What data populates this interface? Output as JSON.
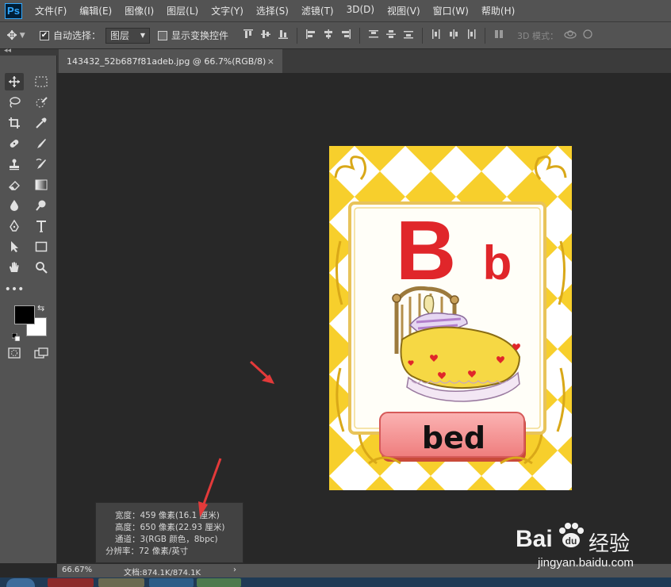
{
  "app": {
    "logo": "Ps"
  },
  "menu": [
    "文件(F)",
    "编辑(E)",
    "图像(I)",
    "图层(L)",
    "文字(Y)",
    "选择(S)",
    "滤镜(T)",
    "3D(D)",
    "视图(V)",
    "窗口(W)",
    "帮助(H)"
  ],
  "options": {
    "auto_select_label": "自动选择：",
    "auto_select_value": "图层",
    "show_transform_label": "显示变换控件",
    "mode_3d_label": "3D 模式："
  },
  "document": {
    "tab_title": "143432_52b687f81adeb.jpg @ 66.7%(RGB/8)",
    "close_glyph": "×"
  },
  "card": {
    "letter_upper": "B",
    "letter_lower": "b",
    "word": "bed",
    "colors": {
      "yellow": "#f7cf2c",
      "red": "#e0262a",
      "label_bg": "#f48c8c",
      "bed_yellow": "#f6d844"
    }
  },
  "status": {
    "zoom": "66.67%",
    "doc_size": "文档:874.1K/874.1K",
    "arrow": "›"
  },
  "info_popup": {
    "width": "宽度：459 像素(16.1 厘米)",
    "height": "高度：650 像素(22.93 厘米)",
    "channels": "通道：3(RGB 颜色，8bpc)",
    "resolution": "分辨率：72 像素/英寸"
  },
  "watermark": {
    "brand": "Bai",
    "brand_suffix": "经验",
    "url": "jingyan.baidu.com"
  }
}
